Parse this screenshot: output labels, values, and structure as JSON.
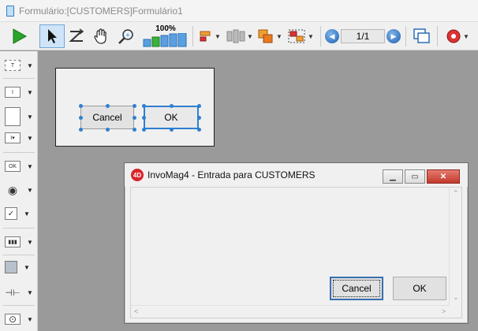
{
  "window": {
    "title": "Formulário:[CUSTOMERS]Formulário1"
  },
  "toolbar": {
    "zoom_label": "100%",
    "page_value": "1/1",
    "icons": [
      "run-icon",
      "pointer-icon",
      "entry-order-icon",
      "hand-icon",
      "zoom-icon",
      "zoom-bars-icon",
      "align-icon",
      "distribute-icon",
      "layer-icon",
      "group-icon",
      "prev-page-icon",
      "next-page-icon",
      "windows-icon",
      "settings-icon"
    ]
  },
  "palette": {
    "items": [
      {
        "name": "text-tool",
        "glyph": "T"
      },
      {
        "name": "field-tool",
        "glyph": "I"
      },
      {
        "name": "list-tool",
        "glyph": ""
      },
      {
        "name": "combo-tool",
        "glyph": "I▾"
      },
      {
        "name": "button-tool",
        "glyph": "OK"
      },
      {
        "name": "radio-tool",
        "glyph": "◉"
      },
      {
        "name": "checkbox-tool",
        "glyph": "✓"
      },
      {
        "name": "indicator-tool",
        "glyph": "▮▮▮"
      },
      {
        "name": "rectangle-tool",
        "glyph": ""
      },
      {
        "name": "splitter-tool",
        "glyph": "⊣⊢"
      },
      {
        "name": "plugin-tool",
        "glyph": "⊙"
      }
    ]
  },
  "editor": {
    "cancel_label": "Cancel",
    "ok_label": "OK"
  },
  "runtime": {
    "title": "InvoMag4 - Entrada para CUSTOMERS",
    "logo": "4D",
    "cancel_label": "Cancel",
    "ok_label": "OK"
  }
}
